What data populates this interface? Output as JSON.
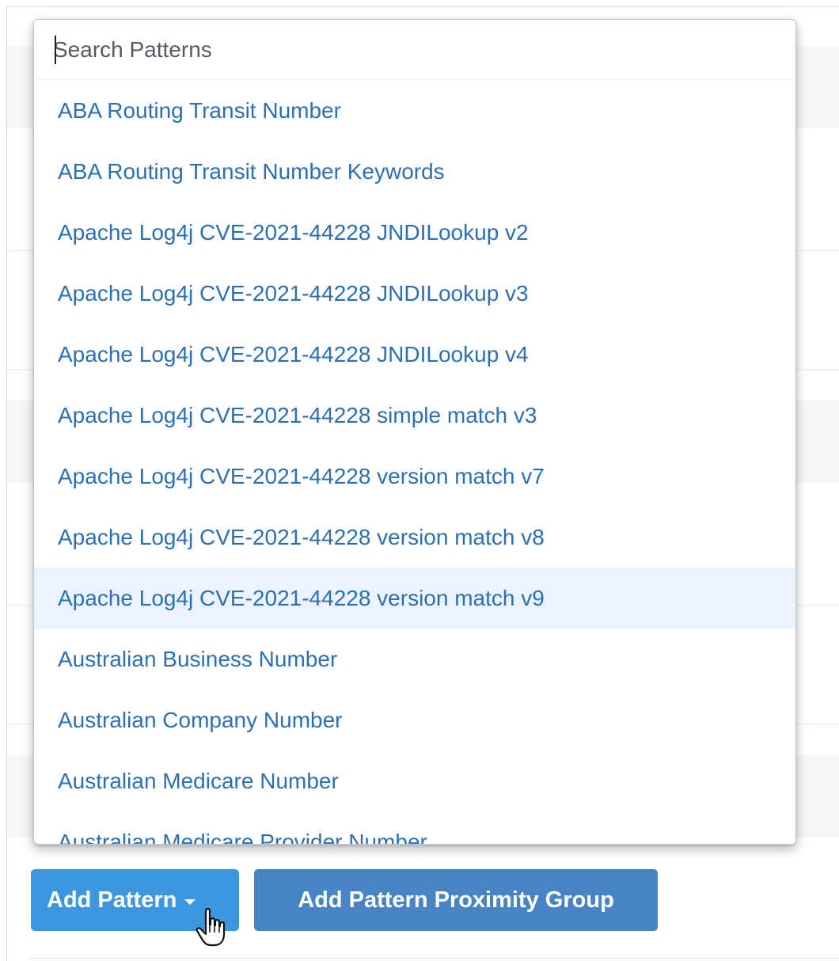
{
  "pattern_dropdown": {
    "search": {
      "placeholder": "Search Patterns",
      "value": ""
    },
    "items": [
      {
        "label": "ABA Routing Transit Number"
      },
      {
        "label": "ABA Routing Transit Number Keywords"
      },
      {
        "label": "Apache Log4j CVE-2021-44228 JNDILookup v2"
      },
      {
        "label": "Apache Log4j CVE-2021-44228 JNDILookup v3"
      },
      {
        "label": "Apache Log4j CVE-2021-44228 JNDILookup v4"
      },
      {
        "label": "Apache Log4j CVE-2021-44228 simple match v3"
      },
      {
        "label": "Apache Log4j CVE-2021-44228 version match v7"
      },
      {
        "label": "Apache Log4j CVE-2021-44228 version match v8"
      },
      {
        "label": "Apache Log4j CVE-2021-44228 version match v9",
        "highlighted": true
      },
      {
        "label": "Australian Business Number"
      },
      {
        "label": "Australian Company Number"
      },
      {
        "label": "Australian Medicare Number"
      },
      {
        "label": "Australian Medicare Provider Number"
      }
    ]
  },
  "buttons": {
    "add_pattern": {
      "label": "Add Pattern",
      "icon": "chevron-down-icon"
    },
    "add_proximity_group": {
      "label": "Add Pattern Proximity Group"
    }
  },
  "cursor": {
    "icon": "hand-cursor-icon"
  },
  "colors": {
    "link": "#2c6fb4",
    "highlight": "#ebf3fd",
    "primary_button": "#3c96e0",
    "secondary_button": "#4884c4"
  }
}
